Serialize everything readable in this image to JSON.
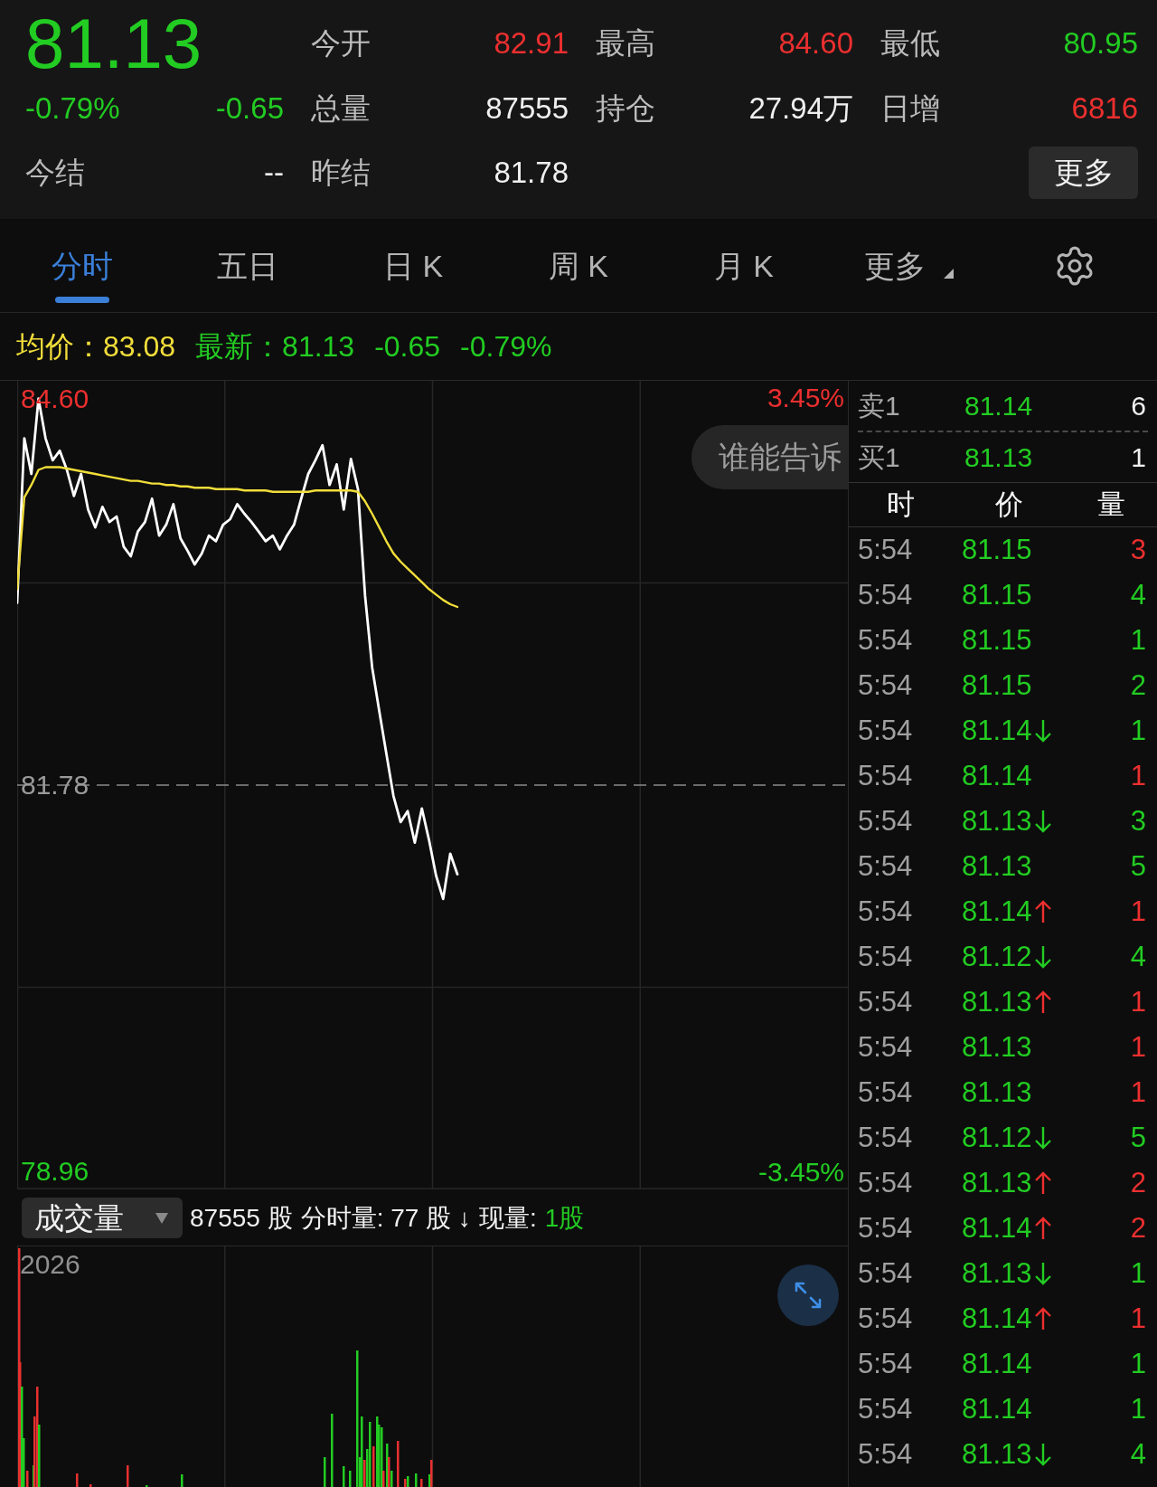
{
  "quote": {
    "price": "81.13",
    "change_pct": "-0.79%",
    "change": "-0.65",
    "color": "#22cc22",
    "settle_label": "今结",
    "settle_value": "--"
  },
  "stats": [
    {
      "label": "今开",
      "value": "82.91",
      "color": "#ec2f2f"
    },
    {
      "label": "最高",
      "value": "84.60",
      "color": "#ec2f2f"
    },
    {
      "label": "最低",
      "value": "80.95",
      "color": "#22cc22"
    },
    {
      "label": "总量",
      "value": "87555",
      "color": "#f0f0f0"
    },
    {
      "label": "持仓",
      "value": "27.94万",
      "color": "#f0f0f0"
    },
    {
      "label": "日增",
      "value": "6816",
      "color": "#ec2f2f"
    },
    {
      "label": "昨结",
      "value": "81.78",
      "color": "#f0f0f0"
    }
  ],
  "more_button": "更多",
  "tabs": [
    {
      "label": "分时",
      "selected": true,
      "kind": "tab"
    },
    {
      "label": "五日",
      "selected": false,
      "kind": "tab"
    },
    {
      "label": "日 K",
      "selected": false,
      "kind": "tab"
    },
    {
      "label": "周 K",
      "selected": false,
      "kind": "tab"
    },
    {
      "label": "月 K",
      "selected": false,
      "kind": "tab"
    },
    {
      "label": "更多",
      "selected": false,
      "kind": "menu"
    }
  ],
  "legend": [
    {
      "text": "均价：83.08",
      "color": "#f2de3a"
    },
    {
      "text": "最新：81.13",
      "color": "#22cc22"
    },
    {
      "text": "-0.65",
      "color": "#22cc22"
    },
    {
      "text": "-0.79%",
      "color": "#22cc22"
    }
  ],
  "price_chart": {
    "right_labels": [
      {
        "text": "3.45%",
        "color": "#ec2f2f"
      },
      {
        "text": "-3.45%",
        "color": "#22cc22"
      }
    ],
    "bubble": "谁能告诉",
    "chart_data": {
      "type": "line",
      "ylim": [
        78.83,
        84.73
      ],
      "yticks": [
        {
          "value": 84.6,
          "label": "84.60"
        },
        {
          "value": 81.78,
          "label": "81.78"
        },
        {
          "value": 78.96,
          "label": "78.96"
        }
      ],
      "ref_lines": [
        {
          "axis": "y",
          "value": 81.78
        }
      ],
      "series": [
        {
          "color": "#ffffff",
          "values": [
            83.11,
            84.31,
            84.05,
            84.6,
            84.31,
            84.15,
            84.22,
            84.08,
            83.89,
            84.05,
            83.79,
            83.66,
            83.81,
            83.7,
            83.74,
            83.52,
            83.45,
            83.63,
            83.7,
            83.87,
            83.6,
            83.68,
            83.83,
            83.58,
            83.49,
            83.39,
            83.47,
            83.6,
            83.56,
            83.68,
            83.72,
            83.83,
            83.76,
            83.7,
            83.63,
            83.56,
            83.6,
            83.5,
            83.6,
            83.68,
            83.87,
            84.05,
            84.15,
            84.26,
            83.97,
            84.12,
            83.79,
            84.16,
            83.94,
            83.16,
            82.64,
            82.32,
            82.01,
            81.7,
            81.51,
            81.59,
            81.36,
            81.61,
            81.38,
            81.12,
            80.95,
            81.28,
            81.13,
            null,
            null,
            null,
            null,
            null,
            null,
            null,
            null,
            null,
            null,
            null,
            null,
            null,
            null,
            null,
            null,
            null,
            null,
            null,
            null,
            null,
            null,
            null,
            null,
            null,
            null,
            null,
            null,
            null,
            null,
            null,
            null,
            null,
            null,
            null,
            null,
            null,
            null,
            null,
            null,
            null,
            null,
            null,
            null,
            null,
            null,
            null,
            null,
            null,
            null,
            null,
            null,
            null,
            null,
            null
          ]
        },
        {
          "color": "#f2de3a",
          "values": [
            83.21,
            83.88,
            83.97,
            84.08,
            84.1,
            84.1,
            84.1,
            84.09,
            84.08,
            84.07,
            84.06,
            84.05,
            84.04,
            84.03,
            84.02,
            84.01,
            84.0,
            84.0,
            83.99,
            83.98,
            83.98,
            83.97,
            83.97,
            83.96,
            83.96,
            83.95,
            83.95,
            83.95,
            83.94,
            83.94,
            83.94,
            83.94,
            83.93,
            83.93,
            83.93,
            83.93,
            83.92,
            83.92,
            83.92,
            83.92,
            83.92,
            83.92,
            83.93,
            83.93,
            83.93,
            83.93,
            83.93,
            83.93,
            83.92,
            83.85,
            83.76,
            83.66,
            83.56,
            83.47,
            83.41,
            83.36,
            83.31,
            83.26,
            83.21,
            83.17,
            83.13,
            83.1,
            83.08,
            null,
            null,
            null,
            null,
            null,
            null,
            null,
            null,
            null,
            null,
            null,
            null,
            null,
            null,
            null,
            null,
            null,
            null,
            null,
            null,
            null,
            null,
            null,
            null,
            null,
            null,
            null,
            null,
            null,
            null,
            null,
            null,
            null,
            null,
            null,
            null,
            null,
            null,
            null,
            null,
            null,
            null,
            null,
            null,
            null,
            null,
            null,
            null,
            null,
            null,
            null,
            null,
            null,
            null,
            null
          ]
        }
      ]
    }
  },
  "volume_panel": {
    "selector": "成交量",
    "summary": [
      {
        "text": "87555 股",
        "color": "#f0f0f0"
      },
      {
        "text": "分时量: 77 股 ↓",
        "color": "#f0f0f0"
      },
      {
        "text": "现量:",
        "color": "#f0f0f0"
      },
      {
        "text": "1股",
        "color": "#22cc22"
      }
    ],
    "axis_label": "2026"
  },
  "order_book": [
    {
      "label": "卖1",
      "price": "81.14",
      "volume": "6"
    },
    {
      "label": "买1",
      "price": "81.13",
      "volume": "1"
    }
  ],
  "trades": {
    "columns": [
      "时",
      "价",
      "量"
    ],
    "rows": [
      {
        "time": "5:54",
        "price": "81.15",
        "kind": "plain",
        "volume": "3",
        "color": "#ec2f2f"
      },
      {
        "time": "5:54",
        "price": "81.15",
        "kind": "plain",
        "volume": "4",
        "color": "#22cc22"
      },
      {
        "time": "5:54",
        "price": "81.15",
        "kind": "plain",
        "volume": "1",
        "color": "#22cc22"
      },
      {
        "time": "5:54",
        "price": "81.15",
        "kind": "plain",
        "volume": "2",
        "color": "#22cc22"
      },
      {
        "time": "5:54",
        "price": "81.14",
        "kind": "downtick",
        "volume": "1",
        "color": "#22cc22"
      },
      {
        "time": "5:54",
        "price": "81.14",
        "kind": "plain",
        "volume": "1",
        "color": "#ec2f2f"
      },
      {
        "time": "5:54",
        "price": "81.13",
        "kind": "downtick",
        "volume": "3",
        "color": "#22cc22"
      },
      {
        "time": "5:54",
        "price": "81.13",
        "kind": "plain",
        "volume": "5",
        "color": "#22cc22"
      },
      {
        "time": "5:54",
        "price": "81.14",
        "kind": "uptick",
        "volume": "1",
        "color": "#ec2f2f"
      },
      {
        "time": "5:54",
        "price": "81.12",
        "kind": "downtick",
        "volume": "4",
        "color": "#22cc22"
      },
      {
        "time": "5:54",
        "price": "81.13",
        "kind": "uptick",
        "volume": "1",
        "color": "#ec2f2f"
      },
      {
        "time": "5:54",
        "price": "81.13",
        "kind": "plain",
        "volume": "1",
        "color": "#ec2f2f"
      },
      {
        "time": "5:54",
        "price": "81.13",
        "kind": "plain",
        "volume": "1",
        "color": "#ec2f2f"
      },
      {
        "time": "5:54",
        "price": "81.12",
        "kind": "downtick",
        "volume": "5",
        "color": "#22cc22"
      },
      {
        "time": "5:54",
        "price": "81.13",
        "kind": "uptick",
        "volume": "2",
        "color": "#ec2f2f"
      },
      {
        "time": "5:54",
        "price": "81.14",
        "kind": "uptick",
        "volume": "2",
        "color": "#ec2f2f"
      },
      {
        "time": "5:54",
        "price": "81.13",
        "kind": "downtick",
        "volume": "1",
        "color": "#22cc22"
      },
      {
        "time": "5:54",
        "price": "81.14",
        "kind": "uptick",
        "volume": "1",
        "color": "#ec2f2f"
      },
      {
        "time": "5:54",
        "price": "81.14",
        "kind": "plain",
        "volume": "1",
        "color": "#22cc22"
      },
      {
        "time": "5:54",
        "price": "81.14",
        "kind": "plain",
        "volume": "1",
        "color": "#22cc22"
      },
      {
        "time": "5:54",
        "price": "81.13",
        "kind": "downtick",
        "volume": "4",
        "color": "#22cc22"
      }
    ]
  }
}
